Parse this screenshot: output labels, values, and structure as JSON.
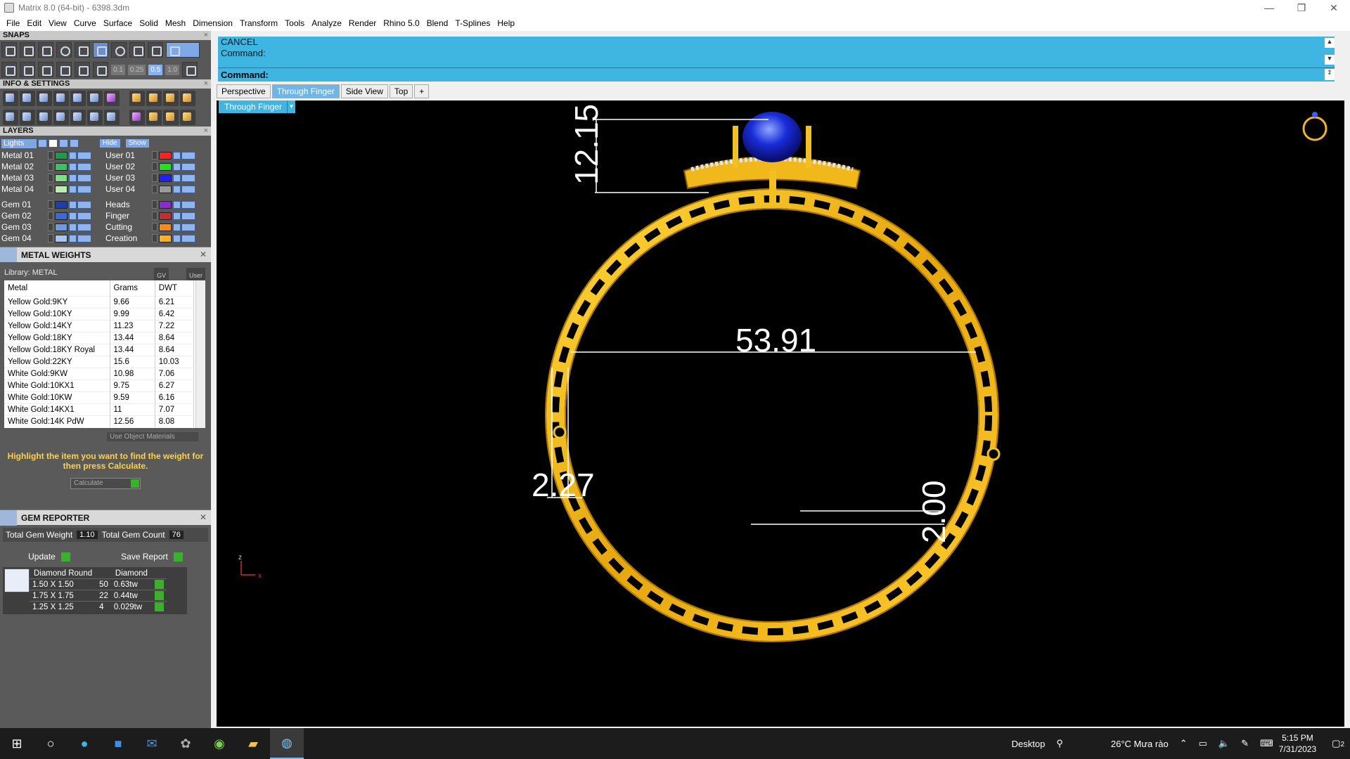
{
  "window": {
    "title": "Matrix 8.0 (64-bit) - 6398.3dm",
    "minimize": "—",
    "restore": "❐",
    "close": "✕"
  },
  "menu": [
    "File",
    "Edit",
    "View",
    "Curve",
    "Surface",
    "Solid",
    "Mesh",
    "Dimension",
    "Transform",
    "Tools",
    "Analyze",
    "Render",
    "Rhino 5.0",
    "Blend",
    "T-Splines",
    "Help"
  ],
  "snaps": {
    "title": "SNAPS",
    "values": [
      "0.1",
      "0.25",
      "0.5",
      "1.0"
    ]
  },
  "info_settings": {
    "title": "INFO & SETTINGS"
  },
  "layers": {
    "title": "LAYERS",
    "lights": "Lights",
    "hide": "Hide",
    "show": "Show",
    "left": [
      {
        "name": "Metal 01",
        "color": "#1e9a4a"
      },
      {
        "name": "Metal 02",
        "color": "#3fbf5f"
      },
      {
        "name": "Metal 03",
        "color": "#7fe07f"
      },
      {
        "name": "Metal 04",
        "color": "#b8f0b0"
      },
      {
        "name": "Gem 01",
        "color": "#1f3fb0"
      },
      {
        "name": "Gem 02",
        "color": "#3a6ad8"
      },
      {
        "name": "Gem 03",
        "color": "#6a9ae8"
      },
      {
        "name": "Gem 04",
        "color": "#a6c6f5"
      }
    ],
    "right": [
      {
        "name": "User 01",
        "color": "#ff2020"
      },
      {
        "name": "User 02",
        "color": "#20e020"
      },
      {
        "name": "User 03",
        "color": "#2020ff"
      },
      {
        "name": "User 04",
        "color": "#9a9a9a"
      },
      {
        "name": "Heads",
        "color": "#8a2ad0"
      },
      {
        "name": "Finger",
        "color": "#c03030"
      },
      {
        "name": "Cutting",
        "color": "#ff8a10"
      },
      {
        "name": "Creation",
        "color": "#ffb020"
      }
    ]
  },
  "metal_weights": {
    "title": "METAL WEIGHTS",
    "library": "Library: METAL",
    "gv": "GV",
    "user": "User",
    "columns": [
      "Metal",
      "Grams",
      "DWT"
    ],
    "rows": [
      [
        "Yellow Gold:9KY",
        "9.66",
        "6.21"
      ],
      [
        "Yellow Gold:10KY",
        "9.99",
        "6.42"
      ],
      [
        "Yellow Gold:14KY",
        "11.23",
        "7.22"
      ],
      [
        "Yellow Gold:18KY",
        "13.44",
        "8.64"
      ],
      [
        "Yellow Gold:18KY Royal",
        "13.44",
        "8.64"
      ],
      [
        "Yellow Gold:22KY",
        "15.6",
        "10.03"
      ],
      [
        "White Gold:9KW",
        "10.98",
        "7.06"
      ],
      [
        "White Gold:10KX1",
        "9.75",
        "6.27"
      ],
      [
        "White Gold:10KW",
        "9.59",
        "6.16"
      ],
      [
        "White Gold:14KX1",
        "11",
        "7.07"
      ],
      [
        "White Gold:14K PdW",
        "12.56",
        "8.08"
      ]
    ],
    "use_object_materials": "Use Object Materials",
    "hint": "Highlight the item you want to find the weight for then press Calculate.",
    "calculate": "Calculate"
  },
  "gem_reporter": {
    "title": "GEM REPORTER",
    "total_weight_label": "Total Gem Weight",
    "total_weight": "1.10",
    "total_count_label": "Total Gem Count",
    "total_count": "76",
    "update": "Update",
    "save_report": "Save Report",
    "columns": [
      "Diamond Round",
      "",
      "Diamond"
    ],
    "rows": [
      [
        "1.50 X 1.50",
        "50",
        "0.63tw"
      ],
      [
        "1.75 X 1.75",
        "22",
        "0.44tw"
      ],
      [
        "1.25 X 1.25",
        "4",
        "0.029tw"
      ]
    ]
  },
  "command": {
    "line1": "CANCEL",
    "line2": "Command:",
    "prompt": "Command:"
  },
  "tabs": [
    "Perspective",
    "Through Finger",
    "Side View",
    "Top",
    "+"
  ],
  "viewport": {
    "label": "Through Finger",
    "dimensions": {
      "height": "12.15",
      "diameter": "53.91",
      "thickness": "2.27",
      "band_width": "2.00"
    },
    "axis_z": "z",
    "axis_x": "x"
  },
  "taskbar": {
    "desktop": "Desktop",
    "weather": "26°C  Mưa rào",
    "time": "5:15 PM",
    "date": "7/31/2023",
    "notifications": "2"
  }
}
